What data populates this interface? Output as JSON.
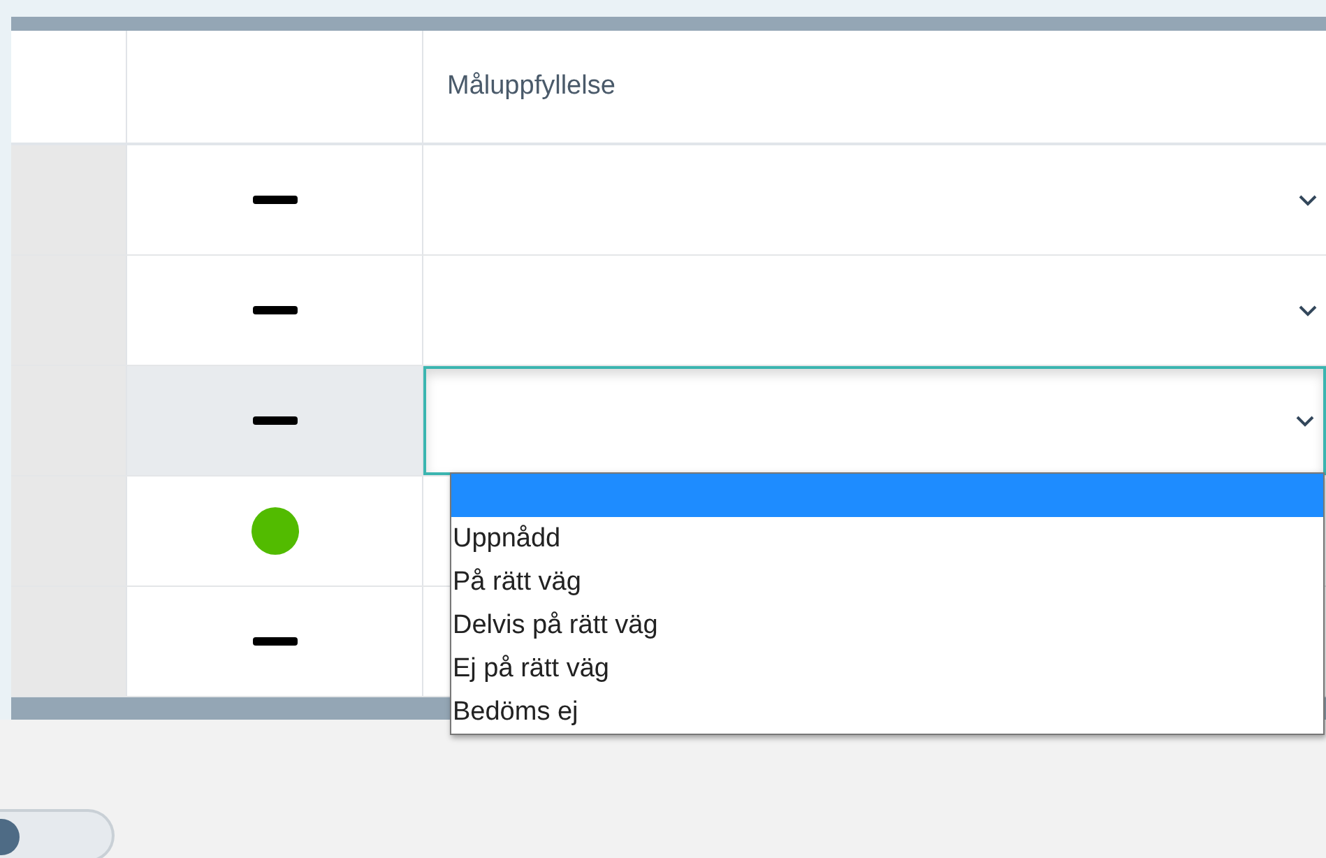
{
  "table": {
    "header": "Måluppfyllelse",
    "rows": [
      {
        "status": {
          "kind": "dash"
        },
        "focused": false
      },
      {
        "status": {
          "kind": "dash"
        },
        "focused": false
      },
      {
        "status": {
          "kind": "dash"
        },
        "focused": true
      },
      {
        "status": {
          "kind": "dot",
          "color": "#52bb00"
        },
        "focused": false
      },
      {
        "status": {
          "kind": "dash"
        },
        "focused": false
      }
    ]
  },
  "dropdown": {
    "open": true,
    "options": [
      {
        "selected": true
      },
      {
        "label": "Uppnådd",
        "selected": false
      },
      {
        "label": "På rätt väg",
        "selected": false
      },
      {
        "label": "Delvis på rätt väg",
        "selected": false
      },
      {
        "label": "Ej på rätt väg",
        "selected": false
      },
      {
        "label": "Bedöms ej",
        "selected": false
      }
    ]
  },
  "toggle": {
    "on": false
  }
}
